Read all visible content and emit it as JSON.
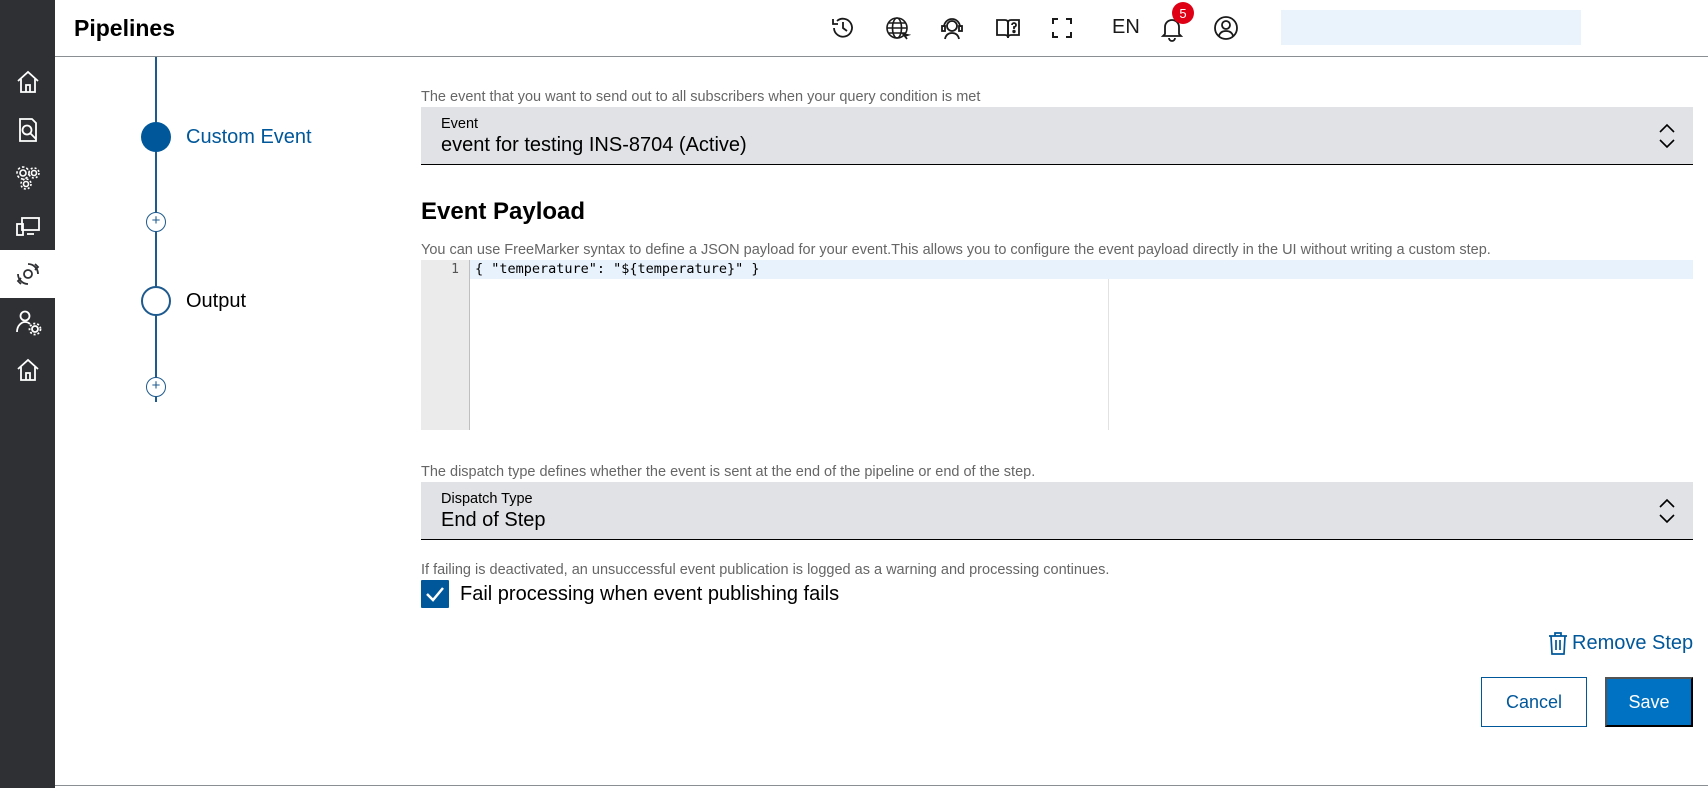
{
  "header": {
    "title": "Pipelines",
    "language": "EN",
    "notification_count": "5"
  },
  "sidebar": {
    "items": [
      {
        "icon": "home-icon"
      },
      {
        "icon": "document-search-icon"
      },
      {
        "icon": "gears-icon"
      },
      {
        "icon": "monitor-icon"
      },
      {
        "icon": "pipeline-gear-icon",
        "active": true
      },
      {
        "icon": "user-settings-icon"
      },
      {
        "icon": "home-outline-icon"
      }
    ]
  },
  "stepper": {
    "steps": [
      {
        "label": "Custom Event",
        "active": true
      },
      {
        "label": "Output",
        "active": false
      }
    ],
    "add_symbol": "+"
  },
  "event": {
    "hint": "The event that you want to send out to all subscribers when your query condition is met",
    "label": "Event",
    "value": "event for testing INS-8704 (Active)"
  },
  "payload": {
    "title": "Event Payload",
    "hint": "You can use FreeMarker syntax to define a JSON payload for your event.This allows you to configure the event payload directly in the UI without writing a custom step.",
    "lines": [
      {
        "number": "1",
        "code": "{ \"temperature\": \"${temperature}\" }"
      }
    ]
  },
  "dispatch": {
    "hint": "The dispatch type defines whether the event is sent at the end of the pipeline or end of the step.",
    "label": "Dispatch Type",
    "value": "End of Step"
  },
  "failure": {
    "hint": "If failing is deactivated, an unsuccessful event publication is logged as a warning and processing continues.",
    "checkbox_label": "Fail processing when event publishing fails",
    "checked": true
  },
  "actions": {
    "remove_step": "Remove Step",
    "cancel": "Cancel",
    "save": "Save"
  },
  "colors": {
    "accent": "#00579a",
    "primary_button": "#0072c3",
    "sidebar": "#2f3033",
    "badge": "#e00015"
  }
}
